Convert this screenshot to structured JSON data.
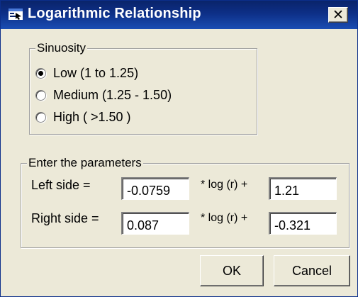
{
  "window": {
    "title": "Logarithmic Relationship",
    "title_icon": "window-app-icon",
    "close_icon": "close-icon",
    "close_glyph": "✕"
  },
  "sinuosity": {
    "legend": "Sinuosity",
    "options": [
      {
        "label": "Low (1 to 1.25)",
        "checked": true
      },
      {
        "label": "Medium (1.25 - 1.50)",
        "checked": false
      },
      {
        "label": "High ( >1.50 )",
        "checked": false
      }
    ]
  },
  "parameters": {
    "legend": "Enter the parameters",
    "left": {
      "label": "Left side =",
      "coefficient": "-0.0759",
      "log_label": "* log (r) +",
      "constant": "1.21"
    },
    "right": {
      "label": "Right side =",
      "coefficient": "0.087",
      "log_label": "* log (r) +",
      "constant": "-0.321"
    }
  },
  "buttons": {
    "ok": "OK",
    "cancel": "Cancel"
  },
  "colors": {
    "titlebar": "#0a246a",
    "face": "#ece9d8"
  }
}
